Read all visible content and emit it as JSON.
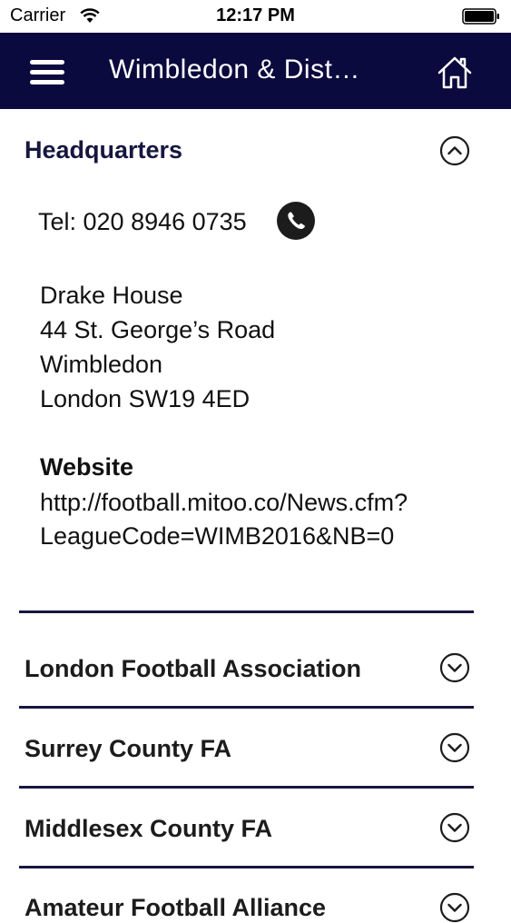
{
  "status_bar": {
    "carrier": "Carrier",
    "time": "12:17 PM",
    "wifi_icon": "wifi-icon",
    "battery_icon": "battery-icon"
  },
  "nav": {
    "title": "Wimbledon & Dist…",
    "menu_icon": "hamburger-menu-icon",
    "home_icon": "home-icon",
    "background_color": "#0b0a3e"
  },
  "headquarters": {
    "title": "Headquarters",
    "tel": "Tel: 020 8946 0735",
    "address": [
      "Drake House",
      "44 St. George’s Road",
      "Wimbledon",
      "London SW19 4ED"
    ],
    "website_label": "Website",
    "website_lines": [
      "http://football.mitoo.co/News.cfm?",
      "LeagueCode=WIMB2016&NB=0"
    ]
  },
  "accordion": [
    {
      "label": "London Football Association"
    },
    {
      "label": "Surrey County FA"
    },
    {
      "label": "Middlesex County FA"
    },
    {
      "label": "Amateur Football Alliance"
    }
  ],
  "colors": {
    "accent": "#16163f",
    "text": "#111111"
  }
}
